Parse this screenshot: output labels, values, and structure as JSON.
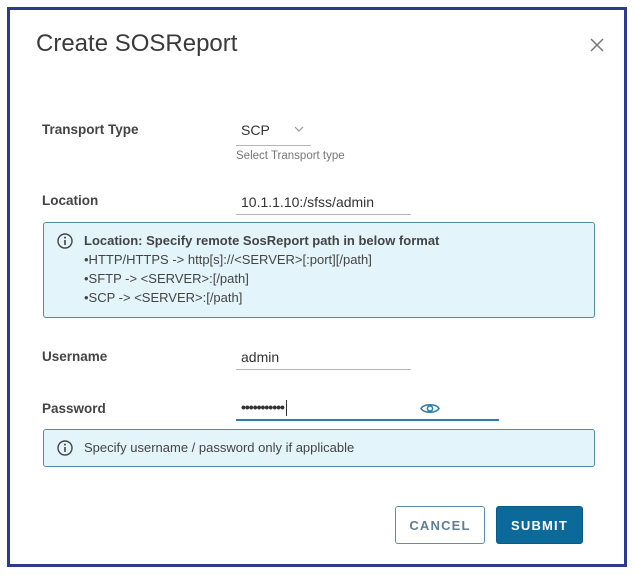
{
  "dialog": {
    "title": "Create SOSReport",
    "transport": {
      "label": "Transport Type",
      "value": "SCP",
      "helper": "Select Transport type"
    },
    "location": {
      "label": "Location",
      "value": "10.1.1.10:/sfss/admin"
    },
    "location_info": {
      "heading": "Location: Specify remote SosReport path in below format",
      "lines": [
        "•HTTP/HTTPS -> http[s]://<SERVER>[:port][/path]",
        "•SFTP -> <SERVER>:[/path]",
        "•SCP -> <SERVER>:[/path]"
      ]
    },
    "username": {
      "label": "Username",
      "value": "admin"
    },
    "password": {
      "label": "Password",
      "value": "•••••••••••"
    },
    "credentials_info": "Specify username / password only if applicable",
    "cancel_label": "CANCEL",
    "submit_label": "SUBMIT"
  },
  "colors": {
    "accent": "#0c6a9b",
    "info_bg": "#e3f4fb",
    "frame": "#2e3a8c"
  }
}
